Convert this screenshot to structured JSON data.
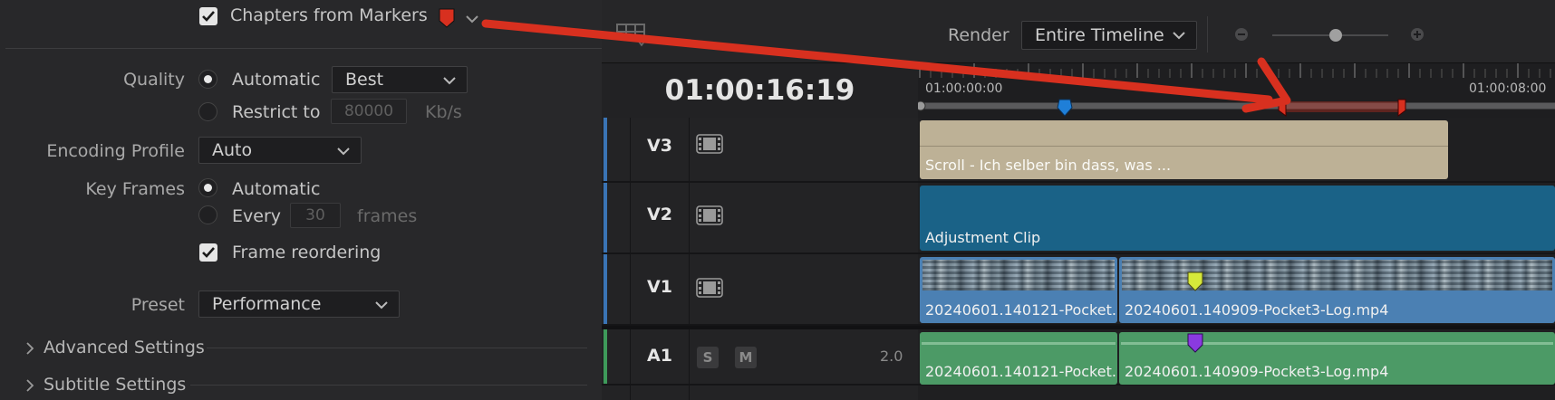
{
  "left_panel": {
    "chapters_from_markers": {
      "label": "Chapters from Markers",
      "checked": true,
      "marker_color": "#d8301f"
    },
    "quality": {
      "label": "Quality",
      "automatic_label": "Automatic",
      "automatic_selected": true,
      "automatic_value": "Best",
      "restrict_label": "Restrict to",
      "restrict_value": "80000",
      "restrict_unit": "Kb/s"
    },
    "encoding_profile": {
      "label": "Encoding Profile",
      "value": "Auto"
    },
    "key_frames": {
      "label": "Key Frames",
      "automatic_label": "Automatic",
      "automatic_selected": true,
      "every_label": "Every",
      "every_value": "30",
      "every_unit": "frames"
    },
    "frame_reordering": {
      "label": "Frame reordering",
      "checked": true
    },
    "preset": {
      "label": "Preset",
      "value": "Performance"
    },
    "advanced_settings": {
      "label": "Advanced Settings"
    },
    "subtitle_settings": {
      "label": "Subtitle Settings"
    }
  },
  "timeline": {
    "render_label": "Render",
    "render_value": "Entire Timeline",
    "timecode": "01:00:16:19",
    "ruler_labels": [
      "01:00:00:00",
      "01:00:08:00"
    ],
    "tracks": [
      {
        "name": "V3",
        "type": "video",
        "clips": [
          {
            "label": "Scroll - Ich selber bin dass, was ..."
          }
        ]
      },
      {
        "name": "V2",
        "type": "video",
        "clips": [
          {
            "label": "Adjustment Clip"
          }
        ]
      },
      {
        "name": "V1",
        "type": "video",
        "clips": [
          {
            "label": "20240601.140121-Pocket..."
          },
          {
            "label": "20240601.140909-Pocket3-Log.mp4"
          }
        ]
      },
      {
        "name": "A1",
        "type": "audio",
        "solo": "S",
        "mute": "M",
        "channels": "2.0",
        "clips": [
          {
            "label": "20240601.140121-Pocket..."
          },
          {
            "label": "20240601.140909-Pocket3-Log.mp4"
          }
        ]
      }
    ],
    "colors": {
      "video_strip": "#3a74b5",
      "audio_strip": "#3e9a5a",
      "v3_clip": "#bdb196",
      "v2_clip": "#1a6287",
      "v1_clip": "#4b80b3",
      "a1_clip": "#4c9a66",
      "marker_blue": "#1f7fd8",
      "marker_red": "#d8301f",
      "marker_yellow": "#d6e83a",
      "marker_purple": "#8a3ae0",
      "annotation_arrow": "#d8301f"
    }
  }
}
